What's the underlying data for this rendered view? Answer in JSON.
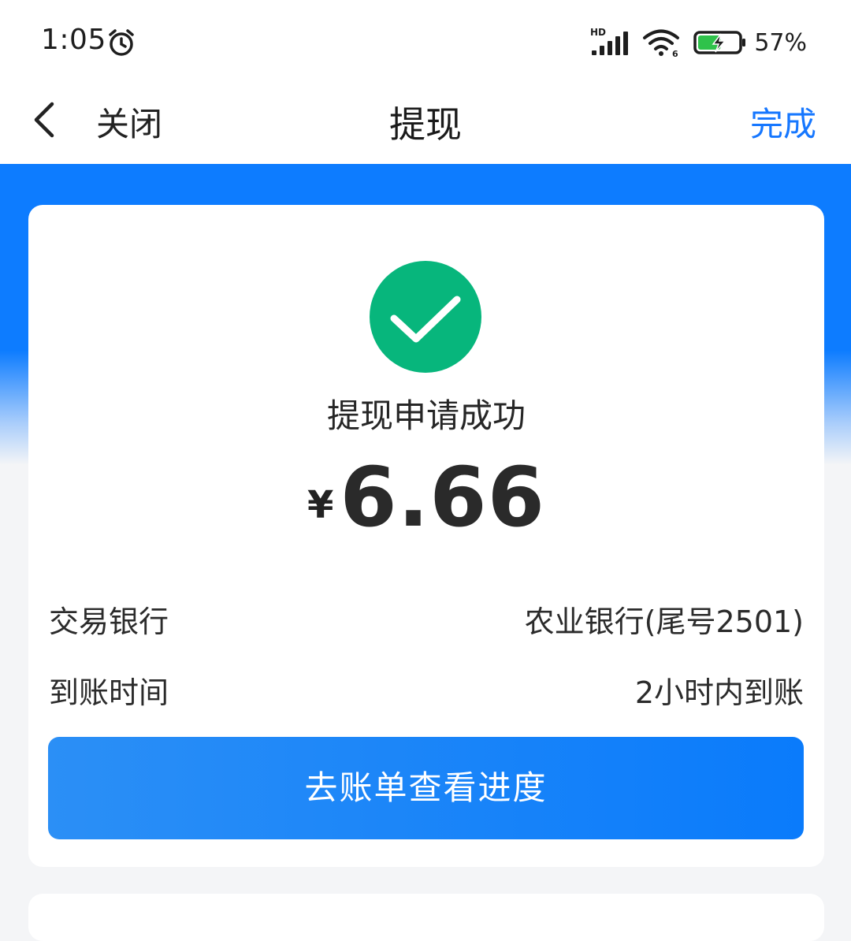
{
  "status_bar": {
    "time": "1:05",
    "network_label": "HD",
    "wifi_label": "6",
    "battery_percent": "57%",
    "battery_level": 0.57,
    "icons": [
      "alarm-icon",
      "signal-icon",
      "wifi-icon",
      "battery-charging-icon"
    ]
  },
  "nav": {
    "close_label": "关闭",
    "title": "提现",
    "done_label": "完成",
    "icons": [
      "back-chevron-icon"
    ]
  },
  "result": {
    "status_icon": "check-circle-icon",
    "title": "提现申请成功",
    "currency": "¥",
    "amount": "6.66",
    "rows": [
      {
        "label": "交易银行",
        "value": "农业银行(尾号2501)"
      },
      {
        "label": "到账时间",
        "value": "2小时内到账"
      }
    ],
    "action_label": "去账单查看进度"
  },
  "colors": {
    "accent_blue": "#1677ff",
    "header_blue": "#0d7cff",
    "success_green": "#07b67c",
    "page_background": "#f4f5f7"
  }
}
